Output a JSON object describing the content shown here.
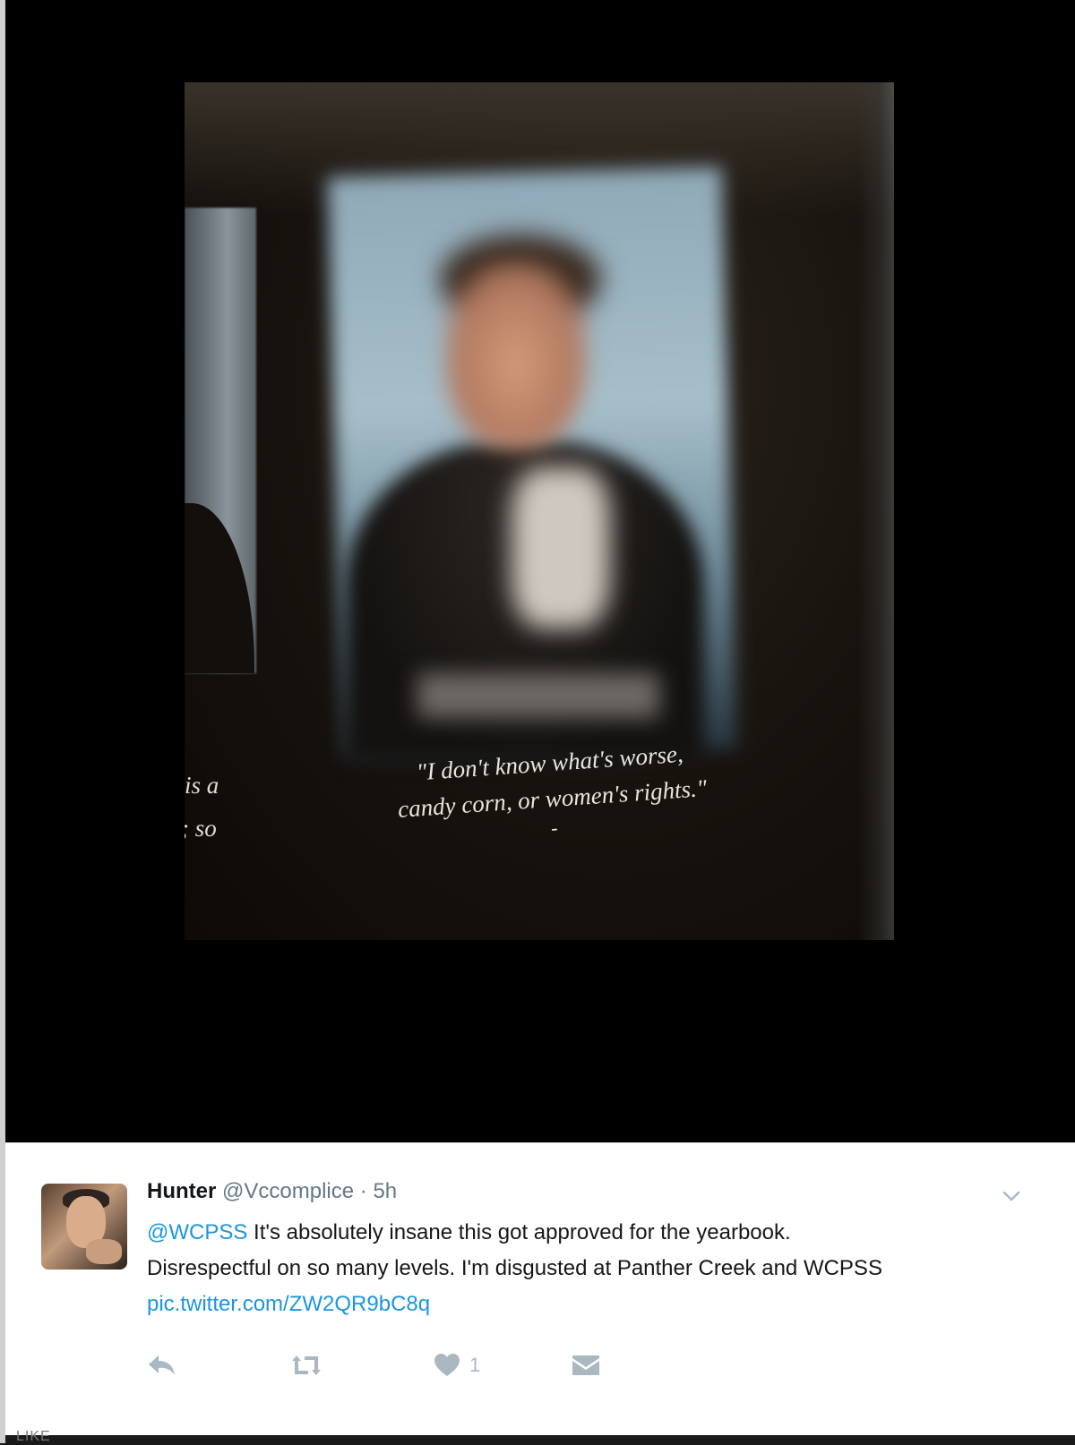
{
  "photo": {
    "quote_line1": "\"I don't know what's worse,",
    "quote_line2": "candy corn, or women's rights.\"",
    "quote_dash": "-",
    "side_text_1": "is a",
    "side_text_2": "; so"
  },
  "tweet": {
    "author_name": "Hunter",
    "author_handle": "@Vccomplice",
    "separator": "·",
    "time": "5h",
    "mention": "@WCPSS",
    "text_1": " It's absolutely insane this got approved for the yearbook.",
    "text_2": "Disrespectful on so many levels. I'm disgusted at Panther Creek and WCPSS",
    "link": "pic.twitter.com/ZW2QR9bC8q",
    "like_count": "1"
  },
  "footer": {
    "label": "LIKE"
  },
  "colors": {
    "link": "#1b95e0",
    "action_icon": "#aab8c2",
    "media_bg": "#000000"
  },
  "icons": [
    "reply-icon",
    "retweet-icon",
    "heart-icon",
    "direct-message-icon",
    "chevron-down-icon"
  ]
}
